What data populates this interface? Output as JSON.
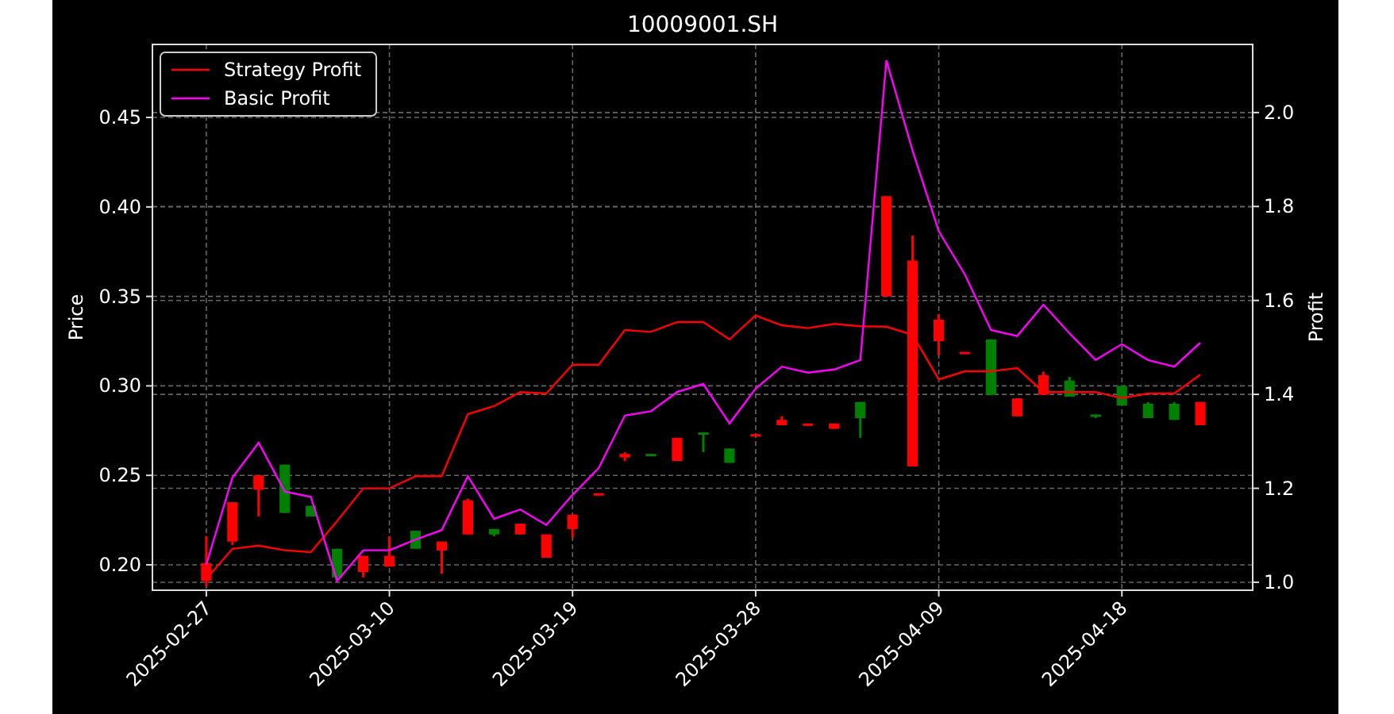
{
  "figure": {
    "title": "10009001.SH",
    "price_chart": {
      "chart_data": {
        "type": "candlestick",
        "ylabel": "Price",
        "ylim": [
          0.1858,
          0.4908
        ],
        "categories": [
          "2025-02-27",
          null,
          null,
          null,
          null,
          null,
          null,
          "2025-03-10",
          null,
          null,
          null,
          null,
          null,
          null,
          "2025-03-19",
          null,
          null,
          null,
          null,
          null,
          null,
          "2025-03-28",
          null,
          null,
          null,
          null,
          null,
          null,
          "2025-04-09",
          null,
          null,
          null,
          null,
          null,
          null,
          "2025-04-18",
          null,
          null,
          null
        ],
        "yticks": [
          {
            "value": 0.2,
            "label": "0.20"
          },
          {
            "value": 0.25,
            "label": "0.25"
          },
          {
            "value": 0.3,
            "label": "0.30"
          },
          {
            "value": 0.35,
            "label": "0.35"
          },
          {
            "value": 0.4,
            "label": "0.40"
          },
          {
            "value": 0.45,
            "label": "0.45"
          }
        ],
        "ohlc": [
          [
            0.191,
            0.216,
            0.188,
            0.201
          ],
          [
            0.213,
            0.235,
            0.211,
            0.235
          ],
          [
            0.242,
            0.25,
            0.227,
            0.25
          ],
          [
            0.256,
            0.256,
            0.229,
            0.229
          ],
          [
            0.233,
            0.233,
            0.227,
            0.227
          ],
          [
            0.209,
            0.209,
            0.192,
            0.193
          ],
          [
            0.196,
            0.205,
            0.193,
            0.205
          ],
          [
            0.199,
            0.216,
            0.199,
            0.205
          ],
          [
            0.219,
            0.219,
            0.209,
            0.209
          ],
          [
            0.208,
            0.213,
            0.195,
            0.213
          ],
          [
            0.217,
            0.237,
            0.217,
            0.236
          ],
          [
            0.22,
            0.22,
            0.216,
            0.217
          ],
          [
            0.217,
            0.223,
            0.217,
            0.223
          ],
          [
            0.204,
            0.217,
            0.204,
            0.217
          ],
          [
            0.22,
            0.228,
            0.215,
            0.228
          ],
          [
            0.239,
            0.24,
            0.239,
            0.24
          ],
          [
            0.26,
            0.263,
            0.258,
            0.262
          ],
          [
            0.262,
            0.262,
            0.261,
            0.261
          ],
          [
            0.258,
            0.271,
            0.258,
            0.271
          ],
          [
            0.274,
            0.274,
            0.263,
            0.273
          ],
          [
            0.265,
            0.265,
            0.257,
            0.257
          ],
          [
            0.272,
            0.273,
            0.272,
            0.273
          ],
          [
            0.278,
            0.283,
            0.278,
            0.281
          ],
          [
            0.278,
            0.279,
            0.278,
            0.279
          ],
          [
            0.276,
            0.279,
            0.276,
            0.279
          ],
          [
            0.291,
            0.291,
            0.271,
            0.282
          ],
          [
            0.35,
            0.406,
            0.35,
            0.406
          ],
          [
            0.255,
            0.384,
            0.255,
            0.37
          ],
          [
            0.325,
            0.34,
            0.317,
            0.337
          ],
          [
            0.318,
            0.319,
            0.318,
            0.319
          ],
          [
            0.326,
            0.326,
            0.295,
            0.295
          ],
          [
            0.283,
            0.293,
            0.283,
            0.293
          ],
          [
            0.295,
            0.308,
            0.295,
            0.306
          ],
          [
            0.303,
            0.305,
            0.294,
            0.294
          ],
          [
            0.284,
            0.284,
            0.282,
            0.283
          ],
          [
            0.3,
            0.3,
            0.289,
            0.289
          ],
          [
            0.29,
            0.291,
            0.282,
            0.282
          ],
          [
            0.29,
            0.291,
            0.281,
            0.281
          ],
          [
            0.278,
            0.291,
            0.278,
            0.291
          ]
        ]
      }
    },
    "profit_chart": {
      "chart_data": {
        "type": "line",
        "ylabel": "Profit",
        "ylim": [
          0.983,
          2.145
        ],
        "legend": "upper left",
        "categories": [
          null,
          null,
          null,
          null,
          null,
          null,
          null,
          null,
          null,
          null,
          null,
          null,
          null,
          null,
          null,
          null,
          null,
          null,
          null,
          null,
          null,
          null,
          null,
          null,
          null,
          null,
          null,
          null,
          null,
          null,
          null,
          null,
          null,
          null,
          null,
          null,
          null,
          null,
          null
        ],
        "yticks": [
          {
            "value": 1.0,
            "label": "1.0"
          },
          {
            "value": 1.2,
            "label": "1.2"
          },
          {
            "value": 1.4,
            "label": "1.4"
          },
          {
            "value": 1.6,
            "label": "1.6"
          },
          {
            "value": 1.8,
            "label": "1.8"
          },
          {
            "value": 2.0,
            "label": "2.0"
          }
        ],
        "series": [
          {
            "name": "Strategy Profit",
            "color": "#ff0000",
            "values": [
              1.007,
              1.071,
              1.078,
              1.068,
              1.064,
              1.13,
              1.2,
              1.2,
              1.226,
              1.226,
              1.358,
              1.375,
              1.405,
              1.402,
              1.463,
              1.463,
              1.537,
              1.533,
              1.554,
              1.554,
              1.517,
              1.568,
              1.547,
              1.541,
              1.55,
              1.545,
              1.544,
              1.527,
              1.432,
              1.449,
              1.449,
              1.456,
              1.405,
              1.405,
              1.405,
              1.392,
              1.402,
              1.402,
              1.442
            ]
          },
          {
            "name": "Basic Profit",
            "color": "#ff00ff",
            "values": [
              1.037,
              1.223,
              1.297,
              1.193,
              1.182,
              1.003,
              1.068,
              1.068,
              1.091,
              1.111,
              1.226,
              1.135,
              1.155,
              1.122,
              1.186,
              1.243,
              1.355,
              1.364,
              1.405,
              1.422,
              1.338,
              1.412,
              1.459,
              1.446,
              1.453,
              1.473,
              2.111,
              1.919,
              1.747,
              1.655,
              1.537,
              1.524,
              1.591,
              1.53,
              1.473,
              1.507,
              1.473,
              1.459,
              1.51
            ]
          }
        ]
      }
    }
  }
}
